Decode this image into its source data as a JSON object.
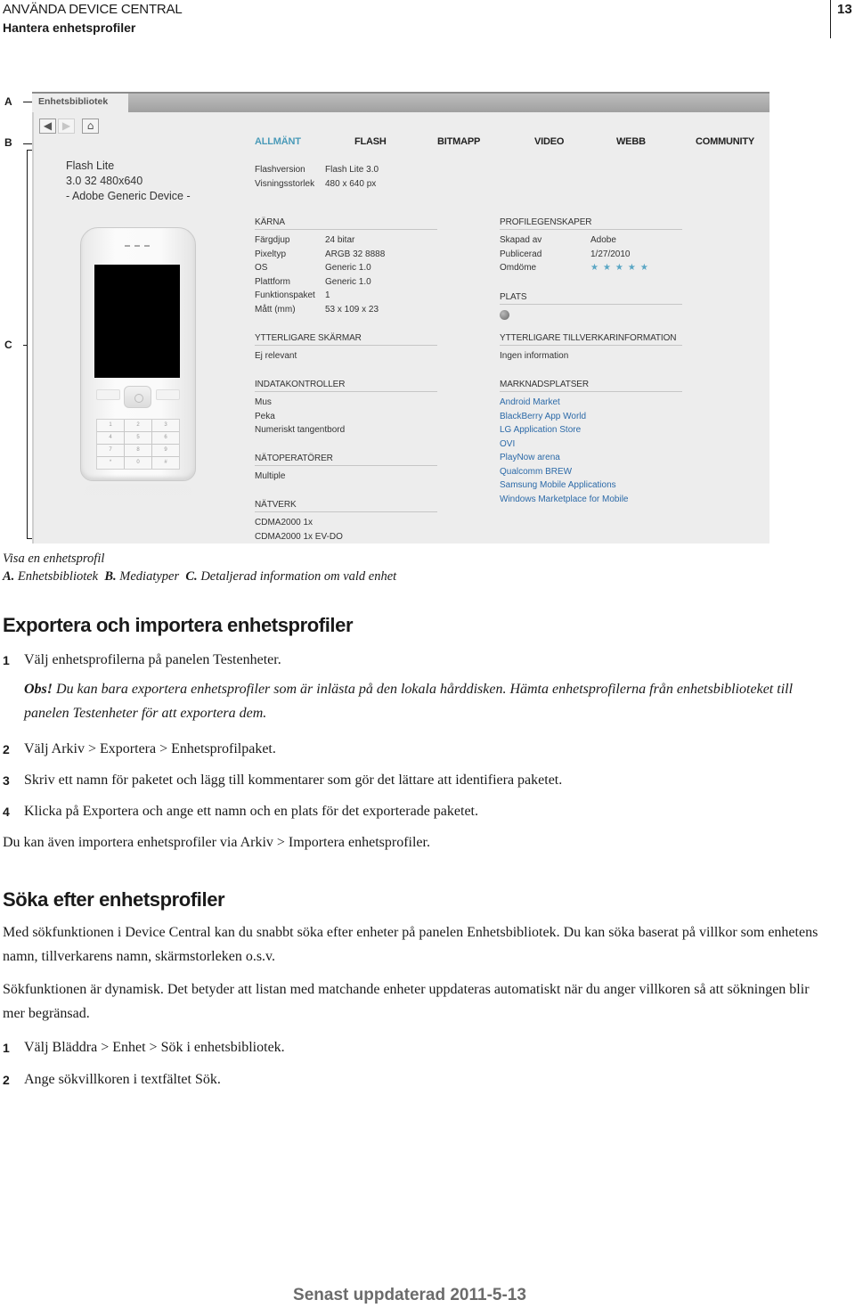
{
  "header": {
    "section": "ANVÄNDA DEVICE CENTRAL",
    "subsection": "Hantera enhetsprofiler",
    "page_number": "13"
  },
  "figure": {
    "callouts": [
      "A",
      "B",
      "C"
    ],
    "panel_tab": "Enhetsbibliotek",
    "nav": {
      "back_icon": "◀",
      "forward_icon": "▶",
      "home_icon": "⌂"
    },
    "device": {
      "line1": "Flash Lite",
      "line2": "3.0 32 480x640",
      "line3": "- Adobe Generic Device -",
      "keypad": [
        "1",
        "2",
        "3",
        "4",
        "5",
        "6",
        "7",
        "8",
        "9",
        "*",
        "0",
        "#"
      ]
    },
    "media_tabs": [
      {
        "label": "ALLMÄNT",
        "active": true
      },
      {
        "label": "FLASH",
        "active": false
      },
      {
        "label": "BITMAPP",
        "active": false
      },
      {
        "label": "VIDEO",
        "active": false
      },
      {
        "label": "WEBB",
        "active": false
      },
      {
        "label": "COMMUNITY",
        "active": false
      }
    ],
    "flash_info": [
      {
        "key": "Flashversion",
        "value": "Flash Lite 3.0"
      },
      {
        "key": "Visningsstorlek",
        "value": "480 x 640 px"
      }
    ],
    "karna": {
      "title": "KÄRNA",
      "rows": [
        {
          "key": "Färgdjup",
          "value": "24 bitar"
        },
        {
          "key": "Pixeltyp",
          "value": "ARGB 32 8888"
        },
        {
          "key": "OS",
          "value": "Generic 1.0"
        },
        {
          "key": "Plattform",
          "value": "Generic 1.0"
        },
        {
          "key": "Funktionspaket",
          "value": "1"
        },
        {
          "key": "Mått (mm)",
          "value": "53 x 109 x 23"
        }
      ]
    },
    "profil": {
      "title": "PROFILEGENSKAPER",
      "rows": [
        {
          "key": "Skapad av",
          "value": "Adobe"
        },
        {
          "key": "Publicerad",
          "value": "1/27/2010"
        },
        {
          "key": "Omdöme",
          "value": "★★★★★"
        }
      ],
      "rating": 5,
      "rating_max": 5,
      "star_color": "#5aa6c4"
    },
    "plats": {
      "title": "PLATS",
      "icon": "globe-icon"
    },
    "ytterligare_skarmar": {
      "title": "YTTERLIGARE SKÄRMAR",
      "value": "Ej relevant"
    },
    "tillverkar": {
      "title": "YTTERLIGARE TILLVERKARINFORMATION",
      "value": "Ingen information"
    },
    "indata": {
      "title": "INDATAKONTROLLER",
      "items": [
        "Mus",
        "Peka",
        "Numeriskt tangentbord"
      ]
    },
    "marknad": {
      "title": "MARKNADSPLATSER",
      "links": [
        "Android Market",
        "BlackBerry App World",
        "LG Application Store",
        "OVI",
        "PlayNow arena",
        "Qualcomm BREW",
        "Samsung Mobile Applications",
        "Windows Marketplace for Mobile"
      ],
      "link_color": "#2c6aa8"
    },
    "natoperatorer": {
      "title": "NÄTOPERATÖRER",
      "value": "Multiple"
    },
    "natverk": {
      "title": "NÄTVERK",
      "items": [
        "CDMA2000 1x",
        "CDMA2000 1x EV-DO"
      ]
    }
  },
  "caption": {
    "title": "Visa en enhetsprofil",
    "a_label": "A.",
    "a_text": "Enhetsbibliotek",
    "b_label": "B.",
    "b_text": "Mediatyper",
    "c_label": "C.",
    "c_text": "Detaljerad information om vald enhet"
  },
  "section1": {
    "heading": "Exportera och importera enhetsprofiler",
    "step1": {
      "n": "1",
      "text": "Välj enhetsprofilerna på panelen Testenheter."
    },
    "note_label": "Obs!",
    "note_text": "Du kan bara exportera enhetsprofiler som är inlästa på den lokala hårddisken. Hämta enhetsprofilerna från enhetsbiblioteket till panelen Testenheter för att exportera dem.",
    "step2": {
      "n": "2",
      "text": "Välj Arkiv > Exportera > Enhetsprofilpaket."
    },
    "step3": {
      "n": "3",
      "text": "Skriv ett namn för paketet och lägg till kommentarer som gör det lättare att identifiera paketet."
    },
    "step4": {
      "n": "4",
      "text": "Klicka på Exportera och ange ett namn och en plats för det exporterade paketet."
    },
    "closing": "Du kan även importera enhetsprofiler via Arkiv > Importera enhetsprofiler."
  },
  "section2": {
    "heading": "Söka efter enhetsprofiler",
    "para1": "Med sökfunktionen i Device Central kan du snabbt söka efter enheter på panelen Enhetsbibliotek. Du kan söka baserat på villkor som enhetens namn, tillverkarens namn, skärmstorleken o.s.v.",
    "para2": "Sökfunktionen är dynamisk. Det betyder att listan med matchande enheter uppdateras automatiskt när du anger villkoren så att sökningen blir mer begränsad.",
    "step1": {
      "n": "1",
      "text": "Välj Bläddra > Enhet > Sök i enhetsbibliotek."
    },
    "step2": {
      "n": "2",
      "text": "Ange sökvillkoren i textfältet Sök."
    }
  },
  "footer": "Senast uppdaterad 2011-5-13"
}
